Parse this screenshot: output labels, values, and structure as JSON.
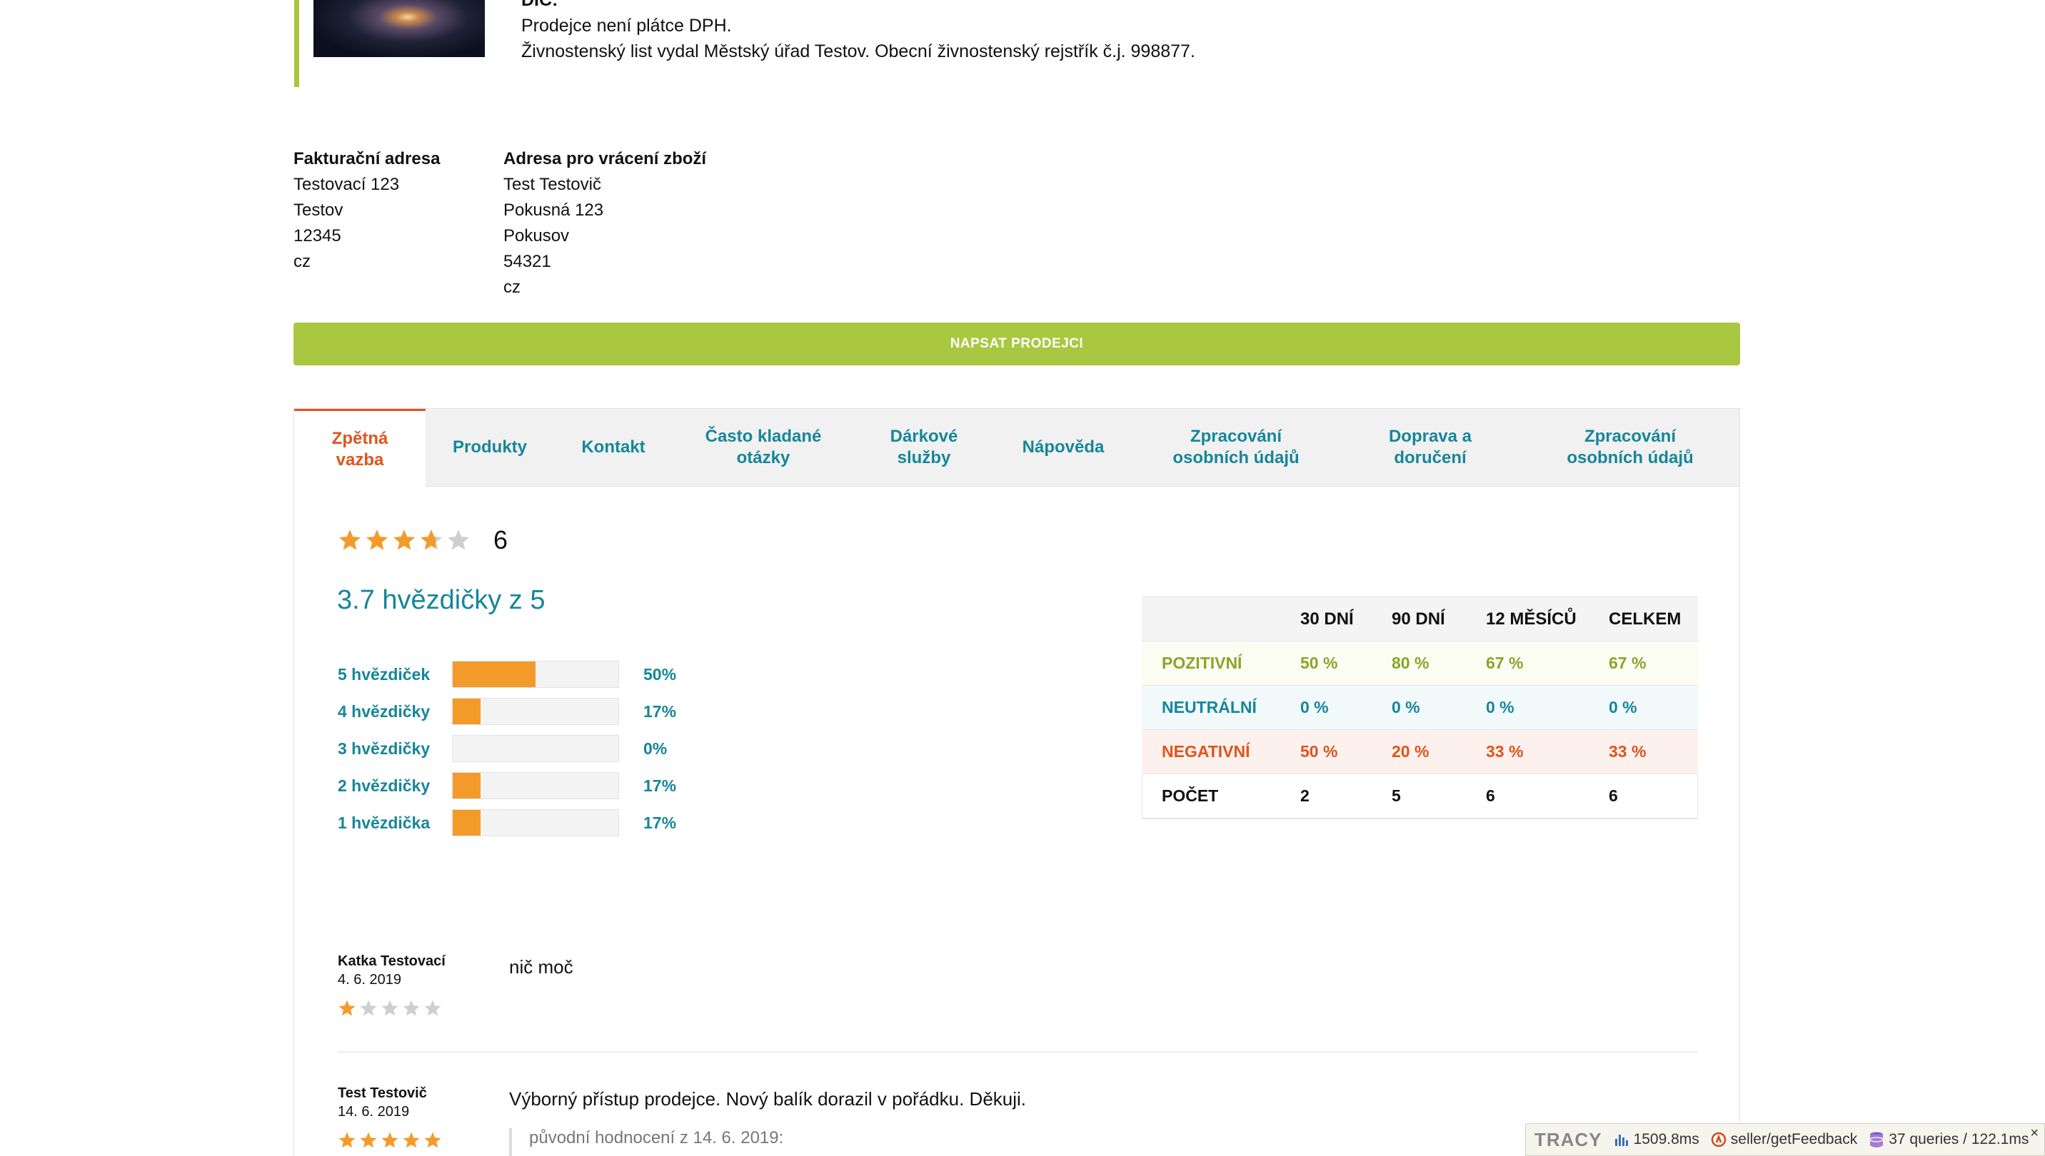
{
  "seller": {
    "dic_label": "DIC:",
    "vat_note": "Prodejce není plátce DPH.",
    "license_note": "Živnostenský list vydal Městský úřad Testov. Obecní živnostenský rejstřík č.j. 998877."
  },
  "billing_address": {
    "title": "Fakturační adresa",
    "lines": [
      "Testovací 123",
      "Testov",
      "12345",
      "cz"
    ]
  },
  "return_address": {
    "title": "Adresa pro vrácení zboží",
    "lines": [
      "Test Testovič",
      "Pokusná 123",
      "Pokusov",
      "54321",
      "cz"
    ]
  },
  "write_button_label": "NAPSAT PRODEJCI",
  "tabs": [
    {
      "label": "Zpětná vazba",
      "active": true
    },
    {
      "label": "Produkty"
    },
    {
      "label": "Kontakt"
    },
    {
      "label": "Často kladané otázky"
    },
    {
      "label": "Dárkové služby"
    },
    {
      "label": "Nápověda"
    },
    {
      "label": "Zpracování osobních údajů"
    },
    {
      "label": "Doprava a doručení"
    },
    {
      "label": "Zpracování osobních údajů"
    }
  ],
  "rating": {
    "average": 3.7,
    "count": "6",
    "title": "3.7 hvězdičky z 5",
    "distribution": [
      {
        "label": "5 hvězdiček",
        "percent": 50,
        "percent_text": "50%"
      },
      {
        "label": "4 hvězdičky",
        "percent": 17,
        "percent_text": "17%"
      },
      {
        "label": "3 hvězdičky",
        "percent": 0,
        "percent_text": "0%"
      },
      {
        "label": "2 hvězdičky",
        "percent": 17,
        "percent_text": "17%"
      },
      {
        "label": "1 hvězdička",
        "percent": 17,
        "percent_text": "17%"
      }
    ]
  },
  "stats_table": {
    "headers": [
      "",
      "30 DNÍ",
      "90 DNÍ",
      "12 MĚSÍCŮ",
      "CELKEM"
    ],
    "rows": [
      {
        "label": "POZITIVNÍ",
        "values": [
          "50 %",
          "80 %",
          "67 %",
          "67 %"
        ]
      },
      {
        "label": "NEUTRÁLNÍ",
        "values": [
          "0 %",
          "0 %",
          "0 %",
          "0 %"
        ]
      },
      {
        "label": "NEGATIVNÍ",
        "values": [
          "50 %",
          "20 %",
          "33 %",
          "33 %"
        ]
      },
      {
        "label": "POČET",
        "values": [
          "2",
          "5",
          "6",
          "6"
        ]
      }
    ]
  },
  "reviews": [
    {
      "author": "Katka Testovací",
      "date": "4. 6. 2019",
      "stars": 1,
      "text": "nič moč"
    },
    {
      "author": "Test Testovič",
      "date": "14. 6. 2019",
      "stars": 5,
      "text": "Výborný přístup prodejce. Nový balík dorazil v pořádku. Děkuji.",
      "original": "původní hodnocení z 14. 6. 2019:"
    }
  ],
  "tracy": {
    "logo": "TRACY",
    "time": "1509.8ms",
    "route": "seller/getFeedback",
    "queries": "37 queries / 122.1ms",
    "close": "×"
  },
  "colors": {
    "accent_green": "#a9c741",
    "teal": "#16869a",
    "orange": "#e0541d",
    "star": "#f39b2a"
  }
}
